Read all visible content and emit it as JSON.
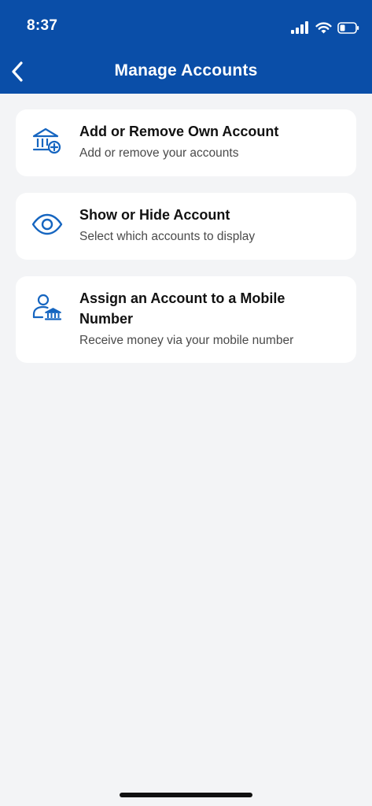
{
  "status_bar": {
    "time": "8:37"
  },
  "header": {
    "title": "Manage Accounts"
  },
  "options": [
    {
      "title": "Add or Remove Own Account",
      "subtitle": "Add or remove your accounts",
      "icon": "bank-add-icon"
    },
    {
      "title": "Show or Hide Account",
      "subtitle": "Select which accounts to display",
      "icon": "eye-icon"
    },
    {
      "title": "Assign an Account to a Mobile Number",
      "subtitle": "Receive money via your mobile number",
      "icon": "person-bank-icon"
    }
  ],
  "colors": {
    "header_background": "#0a4ea8",
    "page_background": "#f3f4f6",
    "icon_accent": "#1565c0",
    "card_background": "#ffffff"
  }
}
